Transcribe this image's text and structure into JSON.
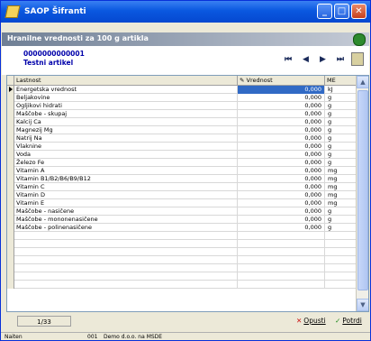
{
  "window": {
    "title": "SAOP Šifranti",
    "buttons": [
      "_",
      "□",
      "✕"
    ]
  },
  "banner": {
    "title": "Hranilne vrednosti za 100 g artikla"
  },
  "article": {
    "code": "0000000000001",
    "name": "Testni artikel"
  },
  "nav": {
    "first": "⏮",
    "prev": "◀",
    "next": "▶",
    "last": "⏭"
  },
  "grid": {
    "columns": {
      "property": "Lastnost",
      "value": "Vrednost",
      "unit": "ME"
    },
    "rows": [
      {
        "name": "Energetska vrednost",
        "value": "0,000",
        "unit": "kJ",
        "selected": true
      },
      {
        "name": "Beljakovine",
        "value": "0,000",
        "unit": "g"
      },
      {
        "name": "Ogljikovi hidrati",
        "value": "0,000",
        "unit": "g"
      },
      {
        "name": "Maščobe - skupaj",
        "value": "0,000",
        "unit": "g"
      },
      {
        "name": "Kalcij Ca",
        "value": "0,000",
        "unit": "g"
      },
      {
        "name": "Magnezij Mg",
        "value": "0,000",
        "unit": "g"
      },
      {
        "name": "Natrij Na",
        "value": "0,000",
        "unit": "g"
      },
      {
        "name": "Vlaknine",
        "value": "0,000",
        "unit": "g"
      },
      {
        "name": "Voda",
        "value": "0,000",
        "unit": "g"
      },
      {
        "name": "Železo Fe",
        "value": "0,000",
        "unit": "g"
      },
      {
        "name": "Vitamin A",
        "value": "0,000",
        "unit": "mg"
      },
      {
        "name": "Vitamin B1/B2/B6/B9/B12",
        "value": "0,000",
        "unit": "mg"
      },
      {
        "name": "Vitamin C",
        "value": "0,000",
        "unit": "mg"
      },
      {
        "name": "Vitamin D",
        "value": "0,000",
        "unit": "mg"
      },
      {
        "name": "Vitamin E",
        "value": "0,000",
        "unit": "mg"
      },
      {
        "name": "Maščobe - nasičene",
        "value": "0,000",
        "unit": "g"
      },
      {
        "name": "Maščobe - mononenasičene",
        "value": "0,000",
        "unit": "g"
      },
      {
        "name": "Maščobe - polinenasičene",
        "value": "0,000",
        "unit": "g"
      },
      {
        "name": "",
        "value": "",
        "unit": ""
      },
      {
        "name": "",
        "value": "",
        "unit": ""
      },
      {
        "name": "",
        "value": "",
        "unit": ""
      },
      {
        "name": "",
        "value": "",
        "unit": ""
      },
      {
        "name": "",
        "value": "",
        "unit": ""
      },
      {
        "name": "",
        "value": "",
        "unit": ""
      },
      {
        "name": "",
        "value": "",
        "unit": ""
      }
    ]
  },
  "footer": {
    "counter": "1/33",
    "cancel_label": "Opusti",
    "ok_label": "Potrdi"
  },
  "status": {
    "mode": "Naiten",
    "code": "001",
    "company": "Demo d.o.o. na MSDE"
  },
  "colors": {
    "title_bar": "#0a58e0",
    "accent_text": "#0000aa",
    "selection": "#316ac5"
  }
}
